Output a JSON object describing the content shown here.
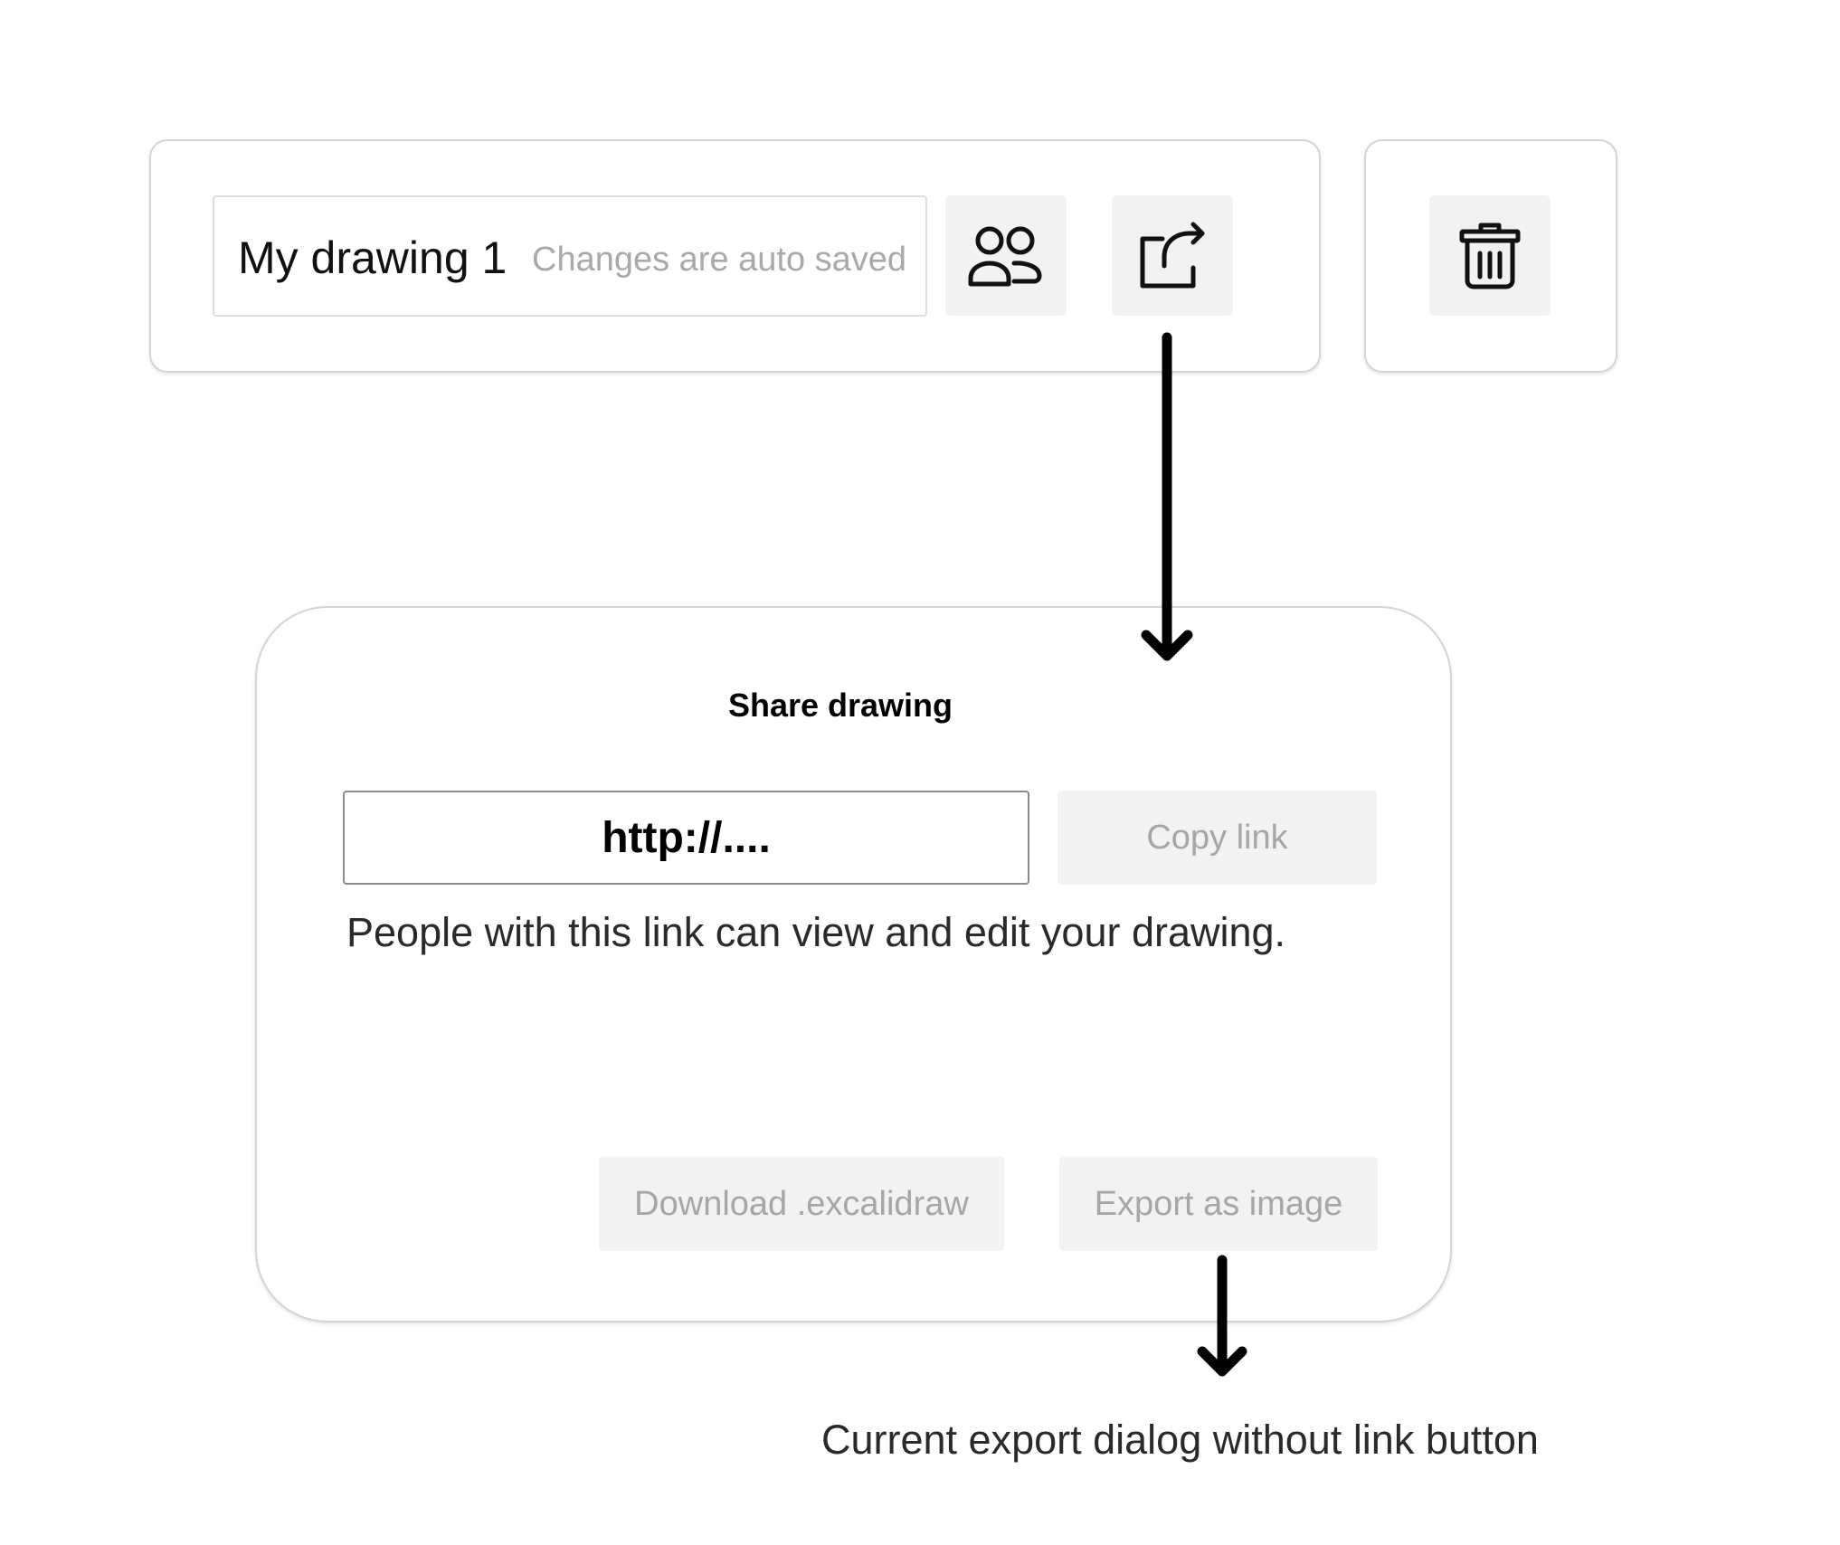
{
  "toolbar": {
    "drawing_name": "My drawing 1",
    "autosave_hint": "Changes are auto saved",
    "collaborate_icon": "users-icon",
    "share_icon": "share-icon",
    "delete_icon": "trash-icon"
  },
  "share_dialog": {
    "title": "Share drawing",
    "link_value": "http://....",
    "copy_label": "Copy link",
    "description": "People with this link can view and edit your drawing.",
    "download_label": "Download .excalidraw",
    "export_label": "Export as image"
  },
  "caption": "Current export dialog without link button",
  "colors": {
    "button_bg": "#f2f2f2",
    "disabled_text": "#a6a6a6",
    "panel_border": "#d4d4d4",
    "arrow": "#000000"
  }
}
